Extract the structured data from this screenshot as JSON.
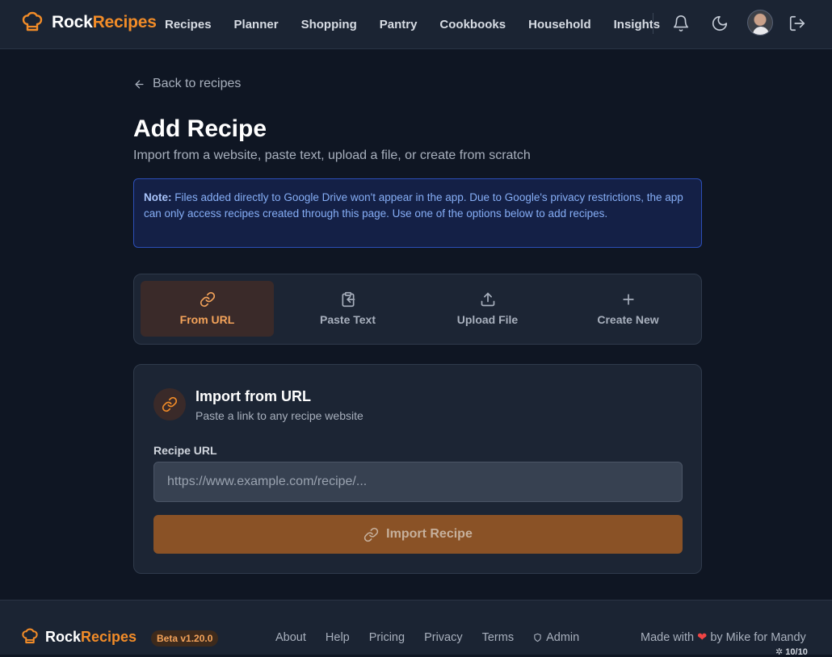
{
  "nav": {
    "brand_rock": "Rock",
    "brand_recipes": "Recipes",
    "links": [
      "Recipes",
      "Planner",
      "Shopping",
      "Pantry",
      "Cookbooks",
      "Household",
      "Insights"
    ],
    "icons": [
      "bell-icon",
      "moon-icon",
      "logout-icon"
    ]
  },
  "page": {
    "back_label": "Back to recipes",
    "title": "Add Recipe",
    "subtitle": "Import from a website, paste text, upload a file, or create from scratch",
    "note_label": "Note:",
    "note_text": " Files added directly to Google Drive won't appear in the app. Due to Google's privacy restrictions, the app can only access recipes created through this page. Use one of the options below to add recipes."
  },
  "tabs": [
    {
      "label": "From URL",
      "icon": "link-icon",
      "active": true
    },
    {
      "label": "Paste Text",
      "icon": "clipboard-icon",
      "active": false
    },
    {
      "label": "Upload File",
      "icon": "upload-icon",
      "active": false
    },
    {
      "label": "Create New",
      "icon": "plus-icon",
      "active": false
    }
  ],
  "import_card": {
    "title": "Import from URL",
    "subtitle": "Paste a link to any recipe website",
    "field_label": "Recipe URL",
    "placeholder": "https://www.example.com/recipe/...",
    "value": "",
    "button_label": "Import Recipe"
  },
  "footer": {
    "brand_rock": "Rock",
    "brand_recipes": "Recipes",
    "beta": "Beta v1.20.0",
    "links": [
      "About",
      "Help",
      "Pricing",
      "Privacy",
      "Terms",
      "Admin"
    ],
    "made_prefix": "Made with",
    "made_suffix": "by Mike for Mandy",
    "corner": "10/10"
  },
  "colors": {
    "accent": "#f28c28",
    "background": "#0f1623",
    "surface": "#1c2534",
    "note_border": "#2c4fb8",
    "button": "#8a5226"
  }
}
